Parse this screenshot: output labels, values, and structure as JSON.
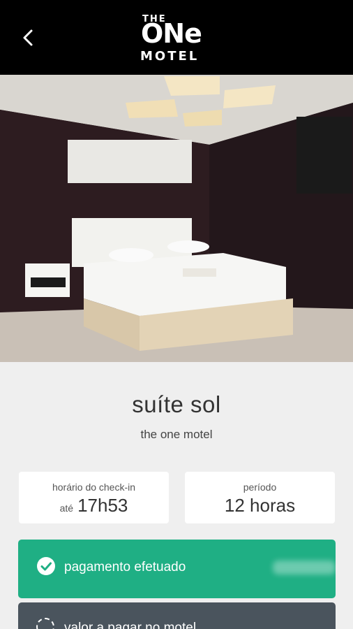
{
  "header": {
    "logo": {
      "line1": "THE",
      "line2": "ONe",
      "line3": "MOTEL"
    }
  },
  "suite": {
    "title": "suíte sol",
    "subtitle": "the one motel"
  },
  "checkin": {
    "label": "horário do check-in",
    "prefix": "até",
    "time": "17h53"
  },
  "period": {
    "label": "período",
    "value": "12 horas"
  },
  "payment": {
    "status_label": "pagamento efetuado",
    "due_label": "valor a pagar no motel"
  },
  "colors": {
    "header_bg": "#000000",
    "page_bg": "#efefef",
    "paid_green": "#1faf84",
    "due_gray": "#4a545d"
  }
}
